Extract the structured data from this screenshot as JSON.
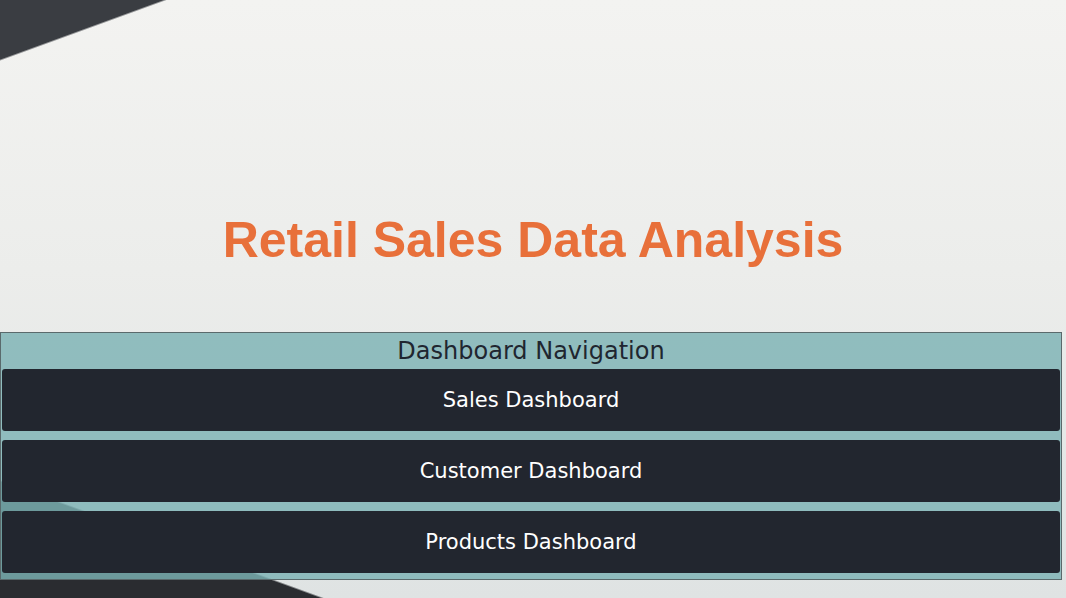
{
  "title": "Retail Sales Data Analysis",
  "navigation": {
    "heading": "Dashboard Navigation",
    "buttons": [
      {
        "label": "Sales Dashboard"
      },
      {
        "label": "Customer Dashboard"
      },
      {
        "label": "Products Dashboard"
      }
    ]
  }
}
